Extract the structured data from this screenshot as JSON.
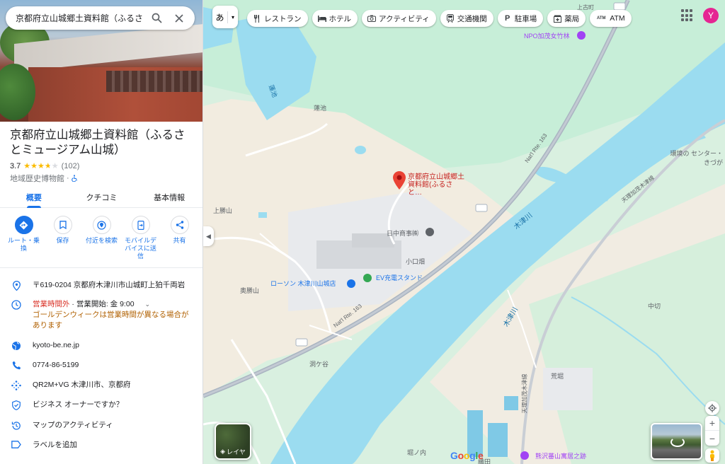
{
  "search": {
    "value": "京都府立山城郷土資料館（ふるさと:",
    "search_icon": "search-icon",
    "close_icon": "close-icon"
  },
  "place": {
    "title": "京都府立山城郷土資料館（ふるさとミュージアム山城）",
    "rating": "3.7",
    "rating_fraction": 0.74,
    "reviews": "(102)",
    "category": "地域歴史博物館",
    "separator": "·"
  },
  "tabs": [
    {
      "label": "概要",
      "active": true
    },
    {
      "label": "クチコミ",
      "active": false
    },
    {
      "label": "基本情報",
      "active": false
    }
  ],
  "actions": [
    {
      "label": "ルート・乗換",
      "icon": "directions-icon"
    },
    {
      "label": "保存",
      "icon": "bookmark-icon"
    },
    {
      "label": "付近を検索",
      "icon": "nearby-icon"
    },
    {
      "label": "モバイルデバイスに送信",
      "icon": "send-to-phone-icon"
    },
    {
      "label": "共有",
      "icon": "share-icon"
    }
  ],
  "info": {
    "address": "〒619-0204 京都府木津川市山城町上狛千両岩",
    "hours_status": "営業時間外",
    "hours_sep": " · ",
    "hours_open": "営業開始: 金 9:00",
    "hours_note": "ゴールデンウィークは営業時間が異なる場合があります",
    "website": "kyoto-be.ne.jp",
    "phone": "0774-86-5199",
    "plus_code": "QR2M+VG 木津川市、京都府",
    "owner": "ビジネス オーナーですか？",
    "activity": "マップのアクティビティ",
    "label": "ラベルを追加"
  },
  "map": {
    "lang_button": "あ",
    "chips": [
      {
        "label": "レストラン",
        "icon": "restaurant-icon"
      },
      {
        "label": "ホテル",
        "icon": "hotel-icon"
      },
      {
        "label": "アクティビティ",
        "icon": "camera-icon"
      },
      {
        "label": "交通機関",
        "icon": "transit-icon"
      },
      {
        "label": "駐車場",
        "icon": "parking-icon"
      },
      {
        "label": "薬局",
        "icon": "pharmacy-icon"
      },
      {
        "label": "ATM",
        "icon": "atm-icon"
      }
    ],
    "avatar": "Y",
    "layers_label": "レイヤ",
    "google": "Google",
    "labels": {
      "npo": "NPO加茂女竹林",
      "hasuike": "蓮池",
      "hasuike_water": "蓮池",
      "museum_pin": "京都府立山城郷土資料館(ふるさと…",
      "kamikatsuyama": "上勝山",
      "nichu": "日中商事㈱",
      "koguchibata": "小口畑",
      "ev": "EV充電スタンド",
      "lawson": "ローソン 木津川山城店",
      "okukatsuyama": "奥勝山",
      "horagaya": "洞ケ谷",
      "kizugawa1": "木津川",
      "kizugawa2": "木津川",
      "route163a": "Nat'l Rte. 163",
      "route163b": "Nat'l Rte. 163",
      "tenri": "天理加茂木津線",
      "tenri2": "天理加茂木津線",
      "center": "環境の センター・きづが",
      "nakagiri": "中切",
      "araha": "荒堀",
      "tsubouchi": "堀ノ内",
      "orita": "織田",
      "kumazawa": "熊沢蕃山寓居之跡",
      "kamigo": "上古町",
      "rte_shield": "163"
    }
  },
  "colors": {
    "accent": "#1a73e8",
    "water": "#9bdcf0",
    "land": "#e9efe6",
    "green": "#b9ecd2",
    "sand": "#f3eee3",
    "road": "#aab4c1",
    "pin": "#ea4335"
  }
}
